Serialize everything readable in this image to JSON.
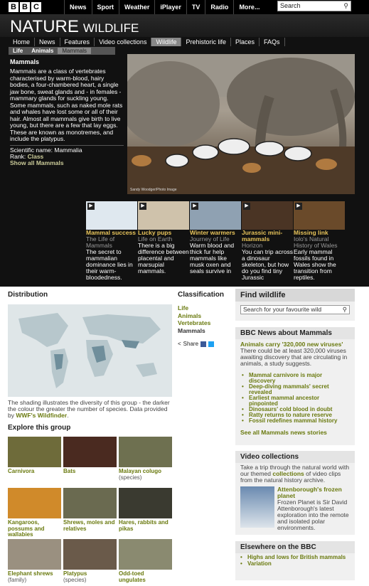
{
  "bbc": {
    "logo": [
      "B",
      "B",
      "C"
    ],
    "nav": [
      "News",
      "Sport",
      "Weather",
      "iPlayer",
      "TV",
      "Radio",
      "More..."
    ],
    "search": "Search"
  },
  "header": {
    "title": "NATURE",
    "subtitle": "WILDLIFE"
  },
  "subnav": [
    "Home",
    "News",
    "Features",
    "Video collections",
    "Wildlife",
    "Prehistoric life",
    "Places",
    "FAQs"
  ],
  "breadcrumb": [
    "Life",
    "Animals",
    "Mammals"
  ],
  "intro": {
    "heading": "Mammals",
    "body": "Mammals are a class of vertebrates characterised by warm-blood, hairy bodies, a four-chambered heart, a single jaw bone, sweat glands and - in females - mammary glands for suckling young. Some mammals, such as naked mole rats and whales have lost some or all of their hair. Almost all mammals give birth to live young, but there are a few that lay eggs. These are known as monotremes, and include the platypus.",
    "sci_label": "Scientific name: Mammalia",
    "rank_label": "Rank:",
    "rank_value": "Class",
    "show_all": "Show all Mammals"
  },
  "hero": {
    "credit": "Sandy Woodger/Photo Image"
  },
  "carousel": [
    {
      "title": "Mammal success",
      "sub": "The Life of Mammals",
      "desc": "The secret to mammalian dominance lies in their warm-bloodedness.",
      "color": "#dfe8ef"
    },
    {
      "title": "Lucky pups",
      "sub": "Life on Earth",
      "desc": "There is a big difference between placental and marsupial mammals.",
      "color": "#cfc2ab"
    },
    {
      "title": "Winter warmers",
      "sub": "Journey of Life",
      "desc": "Warm blood and thick fur help mammals like musk oxen and seals survive in",
      "color": "#8fa1b2"
    },
    {
      "title": "Jurassic mini-mammals",
      "sub": "Horizon",
      "desc": "You can trip across a dinosaur skeleton, but how do you find tiny Jurassic",
      "color": "#4a3424"
    },
    {
      "title": "Missing link",
      "sub": "Iolo's Natural History of Wales",
      "desc": "Early mammal fossils found in Wales show the transition from reptiles.",
      "color": "#6a4a2a"
    }
  ],
  "distribution": {
    "heading": "Distribution",
    "caption": "The shading illustrates the diversity of this group - the darker the colour the greater the number of species. Data provided by",
    "link": "WWF's Wildfinder",
    "period": "."
  },
  "explore": {
    "heading": "Explore this group",
    "items": [
      {
        "label": "Carnivora",
        "sp": "",
        "color": "#6e6b3a"
      },
      {
        "label": "Bats",
        "sp": "",
        "color": "#4a2a20"
      },
      {
        "label": "Malayan colugo",
        "sp": "(species)",
        "color": "#6e7050"
      },
      {
        "label": "Kangaroos, possums and wallabies",
        "sp": "",
        "color": "#d08a2a"
      },
      {
        "label": "Shrews, moles and relatives",
        "sp": "",
        "color": "#6a6a50"
      },
      {
        "label": "Hares, rabbits and pikas",
        "sp": "",
        "color": "#3a3a30"
      },
      {
        "label": "Elephant shrews",
        "sp": "(family)",
        "color": "#9a9080"
      },
      {
        "label": "Platypus",
        "sp": "(species)",
        "color": "#6a5a4a"
      },
      {
        "label": "Odd-toed ungulates",
        "sp": "",
        "color": "#8a8a70"
      }
    ]
  },
  "classification": {
    "heading": "Classification",
    "items": [
      "Life",
      "Animals",
      "Vertebrates",
      "Mammals"
    ],
    "share": "Share"
  },
  "find": {
    "heading": "Find wildlife",
    "placeholder": "Search for your favourite wild"
  },
  "news": {
    "heading": "BBC News about Mammals",
    "lead_title": "Animals carry '320,000 new viruses'",
    "lead_body": "There could be at least 320,000 viruses awaiting discovery that are circulating in animals, a study suggests.",
    "items": [
      "Mammal carnivore is major discovery",
      "Deep-diving mammals' secret revealed",
      "Earliest mammal ancestor pinpointed",
      "Dinosaurs' cold blood in doubt",
      "Ratty returns to nature reserve",
      "Fossil redefines mammal history"
    ],
    "see_all": "See all Mammals news stories"
  },
  "video": {
    "heading": "Video collections",
    "intro_a": "Take a trip through the natural world with our themed",
    "intro_link": "collections",
    "intro_b": "of video clips from the natural history archive.",
    "feature_title": "Attenborough's frozen planet",
    "feature_body": "Frozen Planet is Sir David Attenborough's latest exploration into the remote and isolated polar environments."
  },
  "elsewhere": {
    "heading": "Elsewhere on the BBC",
    "items": [
      "Highs and lows for British mammals",
      "Variation"
    ]
  }
}
